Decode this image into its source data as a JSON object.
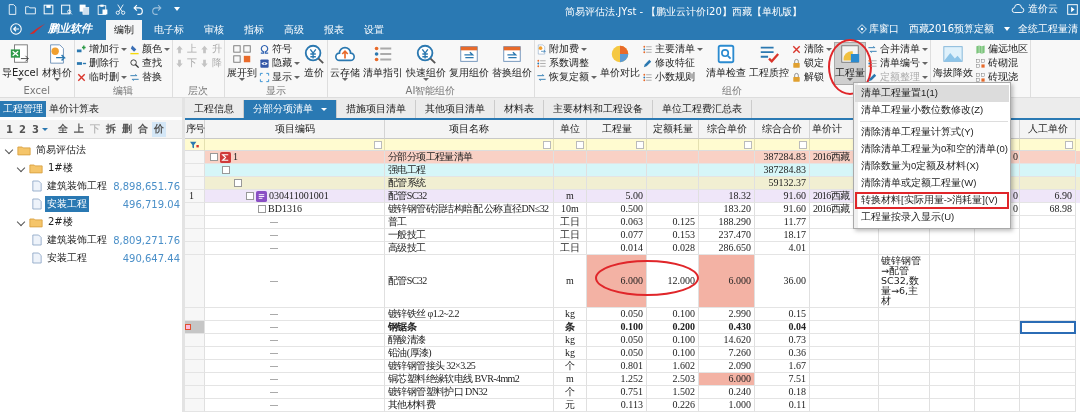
{
  "title_bar": {
    "title": "简易评估法.JYst - 【鹏业云计价i20】西藏【单机版】",
    "cloud_label": "造价云"
  },
  "menu_bar": {
    "brand": "鹏业软件",
    "tabs": [
      {
        "label": "编制",
        "selected": true
      },
      {
        "label": "电子标",
        "selected": false
      },
      {
        "label": "审核",
        "selected": false
      },
      {
        "label": "指标",
        "selected": false
      },
      {
        "label": "高级",
        "selected": false
      },
      {
        "label": "报表",
        "selected": false
      },
      {
        "label": "设置",
        "selected": false
      }
    ],
    "library_window": "库窗口",
    "quota_set": "西藏2016预算定额",
    "bill_set": "全统工程量清"
  },
  "ribbon": {
    "groups": [
      {
        "label": "Excel",
        "columns": [
          [
            {
              "label": "导Excel",
              "dropdown": true,
              "disabled": false,
              "pressed": false,
              "circled": false
            }
          ],
          [
            {
              "label": "材料价",
              "dropdown": true,
              "disabled": false,
              "pressed": false,
              "circled": false
            }
          ]
        ]
      },
      {
        "label": "编辑",
        "columns": [
          [
            {
              "label": "增加行",
              "dropdown": true,
              "disabled": false,
              "pressed": false,
              "circled": false
            },
            {
              "label": "删除行",
              "dropdown": false,
              "disabled": false,
              "pressed": false,
              "circled": false
            },
            {
              "label": "临时删",
              "dropdown": true,
              "disabled": false,
              "pressed": false,
              "circled": false
            }
          ],
          [
            {
              "label": "颜色",
              "dropdown": true,
              "disabled": false,
              "pressed": false,
              "circled": false
            },
            {
              "label": "查找",
              "dropdown": false,
              "disabled": false,
              "pressed": false,
              "circled": false
            },
            {
              "label": "替换",
              "dropdown": false,
              "disabled": false,
              "pressed": false,
              "circled": false
            }
          ]
        ]
      },
      {
        "label": "层次",
        "columns": [
          [
            {
              "label": "上",
              "dropdown": false,
              "disabled": true,
              "pressed": false,
              "circled": false
            },
            {
              "label": "下",
              "dropdown": false,
              "disabled": true,
              "pressed": false,
              "circled": false
            }
          ],
          [
            {
              "label": "升",
              "dropdown": false,
              "disabled": true,
              "pressed": false,
              "circled": false
            },
            {
              "label": "降",
              "dropdown": false,
              "disabled": true,
              "pressed": false,
              "circled": false
            }
          ]
        ]
      },
      {
        "label": "显示",
        "columns": [
          [
            {
              "label": "展开到",
              "dropdown": true,
              "disabled": false,
              "pressed": false,
              "circled": false
            }
          ],
          [
            {
              "label": "符号",
              "dropdown": false,
              "disabled": false,
              "pressed": false,
              "circled": false
            },
            {
              "label": "隐藏",
              "dropdown": true,
              "disabled": false,
              "pressed": false,
              "circled": false
            },
            {
              "label": "显示",
              "dropdown": true,
              "disabled": false,
              "pressed": false,
              "circled": false
            }
          ],
          [
            {
              "label": "造价",
              "dropdown": false,
              "disabled": false,
              "pressed": false,
              "circled": false
            }
          ]
        ]
      },
      {
        "label": "AI智能组价",
        "columns": [
          [
            {
              "label": "云存储",
              "dropdown": true,
              "disabled": false,
              "pressed": false,
              "circled": false
            }
          ],
          [
            {
              "label": "清单指引",
              "dropdown": false,
              "disabled": false,
              "pressed": false,
              "circled": false
            }
          ],
          [
            {
              "label": "快速组价",
              "dropdown": true,
              "disabled": false,
              "pressed": false,
              "circled": false
            }
          ],
          [
            {
              "label": "复用组价",
              "dropdown": false,
              "disabled": false,
              "pressed": false,
              "circled": false
            }
          ],
          [
            {
              "label": "替换组价",
              "dropdown": false,
              "disabled": false,
              "pressed": false,
              "circled": false
            }
          ]
        ]
      },
      {
        "label": "组价",
        "columns": [
          [
            {
              "label": "附加费",
              "dropdown": true,
              "disabled": false,
              "pressed": false,
              "circled": false
            },
            {
              "label": "系数调整",
              "dropdown": false,
              "disabled": false,
              "pressed": false,
              "circled": false
            },
            {
              "label": "恢复定额",
              "dropdown": true,
              "disabled": false,
              "pressed": false,
              "circled": false
            }
          ],
          [
            {
              "label": "单价对比",
              "dropdown": false,
              "disabled": false,
              "pressed": false,
              "circled": false
            }
          ],
          [
            {
              "label": "主要清单",
              "dropdown": true,
              "disabled": false,
              "pressed": false,
              "circled": false
            },
            {
              "label": "修改特征",
              "dropdown": false,
              "disabled": false,
              "pressed": false,
              "circled": false
            },
            {
              "label": "小数规则",
              "dropdown": false,
              "disabled": false,
              "pressed": false,
              "circled": false
            }
          ],
          [
            {
              "label": "清单检查",
              "dropdown": false,
              "disabled": false,
              "pressed": false,
              "circled": false
            }
          ],
          [
            {
              "label": "工程质控",
              "dropdown": false,
              "disabled": false,
              "pressed": false,
              "circled": false
            }
          ],
          [
            {
              "label": "清除",
              "dropdown": true,
              "disabled": false,
              "pressed": false,
              "circled": false
            },
            {
              "label": "锁定",
              "dropdown": false,
              "disabled": false,
              "pressed": false,
              "circled": false
            },
            {
              "label": "解锁",
              "dropdown": false,
              "disabled": false,
              "pressed": false,
              "circled": false
            }
          ],
          [
            {
              "label": "工程量",
              "dropdown": true,
              "disabled": false,
              "pressed": true,
              "circled": true
            }
          ],
          [
            {
              "label": "合并清单",
              "dropdown": true,
              "disabled": false,
              "pressed": false,
              "circled": false
            },
            {
              "label": "清单编号",
              "dropdown": true,
              "disabled": false,
              "pressed": false,
              "circled": false
            },
            {
              "label": "定额整理",
              "dropdown": true,
              "disabled": true,
              "pressed": false,
              "circled": false
            }
          ]
        ]
      },
      {
        "columns": [
          [
            {
              "label": "海拔降效",
              "dropdown": false,
              "disabled": false,
              "pressed": false,
              "circled": false
            }
          ],
          [
            {
              "label": "偏远地区",
              "dropdown": false,
              "disabled": false,
              "pressed": false,
              "circled": false
            },
            {
              "label": "砖砌混",
              "dropdown": false,
              "disabled": false,
              "pressed": false,
              "circled": false
            },
            {
              "label": "砖现浇",
              "dropdown": false,
              "disabled": false,
              "pressed": false,
              "circled": false
            }
          ]
        ]
      }
    ]
  },
  "side_panel": {
    "tabs": [
      {
        "label": "工程管理",
        "selected": true
      },
      {
        "label": "单价计算表",
        "selected": false
      }
    ],
    "toolbar": [
      {
        "label": "1",
        "dropdown": false,
        "disabled": false,
        "selected": false
      },
      {
        "label": "2",
        "dropdown": false,
        "disabled": false,
        "selected": false
      },
      {
        "label": "3",
        "dropdown": true,
        "disabled": false,
        "selected": false
      },
      {
        "label": "全",
        "dropdown": false,
        "disabled": false,
        "selected": false
      },
      {
        "label": "上",
        "dropdown": false,
        "disabled": false,
        "selected": false
      },
      {
        "label": "下",
        "dropdown": false,
        "disabled": true,
        "selected": false
      },
      {
        "label": "拆",
        "dropdown": false,
        "disabled": false,
        "selected": false
      },
      {
        "label": "删",
        "dropdown": false,
        "disabled": false,
        "selected": false
      },
      {
        "label": "合",
        "dropdown": false,
        "disabled": false,
        "selected": false
      },
      {
        "label": "价",
        "dropdown": false,
        "disabled": false,
        "selected": true
      }
    ],
    "tree": [
      {
        "label": "简易评估法",
        "expanded": true,
        "selected": false,
        "children": [
          {
            "label": "1#楼",
            "expanded": true,
            "selected": false,
            "children": [
              {
                "label": "建筑装饰工程",
                "amount": "8,898,651.76",
                "selected": false
              },
              {
                "label": "安装工程",
                "amount": "496,719.04",
                "selected": true
              }
            ]
          },
          {
            "label": "2#楼",
            "expanded": true,
            "selected": false,
            "children": [
              {
                "label": "建筑装饰工程",
                "amount": "8,809,271.76",
                "selected": false
              },
              {
                "label": "安装工程",
                "amount": "490,647.44",
                "selected": false
              }
            ]
          }
        ]
      }
    ]
  },
  "doc_tabs": [
    {
      "label": "工程信息",
      "selected": false,
      "dropdown": false
    },
    {
      "label": "分部分项清单",
      "selected": true,
      "dropdown": true
    },
    {
      "label": "措施项目清单",
      "selected": false,
      "dropdown": false
    },
    {
      "label": "其他项目清单",
      "selected": false,
      "dropdown": false
    },
    {
      "label": "材料表",
      "selected": false,
      "dropdown": false
    },
    {
      "label": "主要材料和工程设备",
      "selected": false,
      "dropdown": false
    },
    {
      "label": "单位工程费汇总表",
      "selected": false,
      "dropdown": false
    }
  ],
  "table": {
    "columns": [
      {
        "label": "序号",
        "filter": false
      },
      {
        "label": "项目编码",
        "filter": true
      },
      {
        "label": "项目名称",
        "filter": true
      },
      {
        "label": "单位",
        "filter": true
      },
      {
        "label": "工程量",
        "filter": true
      },
      {
        "label": "定额耗量",
        "filter": false
      },
      {
        "label": "综合单价",
        "filter": true
      },
      {
        "label": "综合合价",
        "filter": true
      },
      {
        "label": "单价计"
      },
      {},
      {},
      {},
      {
        "label": "人工单价",
        "filter": true
      }
    ],
    "rows": [
      {
        "kind": "section",
        "selected": false,
        "bold": false,
        "circled": false,
        "highlight_qty": false,
        "highlight_unit_price": false,
        "code": "1",
        "name": "分部分项工程量清单",
        "total": "387284.83",
        "pricing": "2016西藏",
        "column_12": "0"
      },
      {
        "kind": "subsection",
        "selected": false,
        "bold": false,
        "circled": false,
        "highlight_qty": false,
        "highlight_unit_price": false,
        "name": "强电工程",
        "total": "387284.83"
      },
      {
        "kind": "system",
        "selected": false,
        "bold": false,
        "circled": false,
        "highlight_qty": false,
        "highlight_unit_price": false,
        "name": "配管系统",
        "total": "59132.37"
      },
      {
        "kind": "item",
        "selected": false,
        "bold": false,
        "circled": false,
        "highlight_qty": false,
        "highlight_unit_price": false,
        "no": "1",
        "code": "030411001001",
        "name": "配管SC32",
        "unit": "m",
        "qty": "5.00",
        "unit_price": "18.32",
        "total": "91.60",
        "pricing": "2016西藏",
        "column_12": "0",
        "labor_price": "6.90"
      },
      {
        "kind": "quota",
        "selected": false,
        "bold": false,
        "circled": false,
        "highlight_qty": false,
        "highlight_unit_price": false,
        "code": "BD1316",
        "name": "镀锌钢管砖混结构暗配 公称直径DN≤32",
        "unit": "10m",
        "qty": "0.500",
        "unit_price": "183.20",
        "total": "91.60",
        "pricing": "2016西藏",
        "column_12": "0",
        "labor_price": "68.98"
      },
      {
        "kind": "resource",
        "selected": false,
        "bold": false,
        "circled": false,
        "highlight_qty": false,
        "highlight_unit_price": false,
        "name": "普工",
        "unit": "工日",
        "qty": "0.063",
        "consumption": "0.125",
        "unit_price": "188.290",
        "total": "11.77"
      },
      {
        "kind": "resource",
        "selected": false,
        "bold": false,
        "circled": false,
        "highlight_qty": false,
        "highlight_unit_price": false,
        "name": "一般技工",
        "unit": "工日",
        "qty": "0.077",
        "consumption": "0.153",
        "unit_price": "237.470",
        "total": "18.17"
      },
      {
        "kind": "resource",
        "selected": false,
        "bold": false,
        "circled": false,
        "highlight_qty": false,
        "highlight_unit_price": false,
        "name": "高级技工",
        "unit": "工日",
        "qty": "0.014",
        "consumption": "0.028",
        "unit_price": "286.650",
        "total": "4.01"
      },
      {
        "kind": "resource",
        "selected": false,
        "bold": false,
        "circled": true,
        "highlight_qty": true,
        "highlight_unit_price": true,
        "name": "配管SC32",
        "unit": "m",
        "qty": "6.000",
        "consumption": "12.000",
        "unit_price": "6.000",
        "total": "36.00",
        "column_10": "镀锌钢管→配管SC32,数量→6,主材"
      },
      {
        "kind": "resource",
        "selected": false,
        "bold": false,
        "circled": false,
        "highlight_qty": false,
        "highlight_unit_price": false,
        "name": "镀锌铁丝 φ1.2~2.2",
        "unit": "kg",
        "qty": "0.050",
        "consumption": "0.100",
        "unit_price": "2.990",
        "total": "0.15"
      },
      {
        "kind": "resource",
        "selected": true,
        "bold": true,
        "circled": false,
        "highlight_qty": false,
        "highlight_unit_price": false,
        "name": "钢锯条",
        "unit": "条",
        "qty": "0.100",
        "consumption": "0.200",
        "unit_price": "0.430",
        "total": "0.04"
      },
      {
        "kind": "resource",
        "selected": false,
        "bold": false,
        "circled": false,
        "highlight_qty": false,
        "highlight_unit_price": false,
        "name": "醇酸清漆",
        "unit": "kg",
        "qty": "0.050",
        "consumption": "0.100",
        "unit_price": "14.620",
        "total": "0.73"
      },
      {
        "kind": "resource",
        "selected": false,
        "bold": false,
        "circled": false,
        "highlight_qty": false,
        "highlight_unit_price": false,
        "name": "铅油(厚漆)",
        "unit": "kg",
        "qty": "0.050",
        "consumption": "0.100",
        "unit_price": "7.260",
        "total": "0.36"
      },
      {
        "kind": "resource",
        "selected": false,
        "bold": false,
        "circled": false,
        "highlight_qty": false,
        "highlight_unit_price": false,
        "name": "镀锌钢管接头 32×3.25",
        "unit": "个",
        "qty": "0.801",
        "consumption": "1.602",
        "unit_price": "2.090",
        "total": "1.67"
      },
      {
        "kind": "resource",
        "selected": false,
        "bold": false,
        "circled": false,
        "highlight_qty": false,
        "highlight_unit_price": true,
        "name": "铜芯塑料绝缘软电线 BVR-4mm2",
        "unit": "m",
        "qty": "1.252",
        "consumption": "2.503",
        "unit_price": "6.000",
        "total": "7.51"
      },
      {
        "kind": "resource",
        "selected": false,
        "bold": false,
        "circled": false,
        "highlight_qty": false,
        "highlight_unit_price": false,
        "name": "镀锌钢管塑料护口 DN32",
        "unit": "个",
        "qty": "0.751",
        "consumption": "1.502",
        "unit_price": "0.240",
        "total": "0.18"
      },
      {
        "kind": "resource",
        "selected": false,
        "bold": false,
        "circled": false,
        "highlight_qty": false,
        "highlight_unit_price": false,
        "name": "其他材料费",
        "unit": "元",
        "qty": "0.113",
        "consumption": "0.226",
        "unit_price": "1.000",
        "total": "0.11"
      }
    ]
  },
  "context_menu": {
    "items": [
      {
        "label": "清单工程量置1(1)",
        "selected": true,
        "boxed": false
      },
      {
        "label": "清单工程量小数位数修改(Z)",
        "selected": false,
        "boxed": false
      },
      {
        "label": "清除清单工程量计算式(Y)",
        "selected": false,
        "boxed": false
      },
      {
        "label": "清除清单工程量为0和空的清单(0)",
        "selected": false,
        "boxed": false
      },
      {
        "label": "清除数量为0定额及材料(X)",
        "selected": false,
        "boxed": false
      },
      {
        "label": "清除清单或定额工程量(W)",
        "selected": false,
        "boxed": false
      },
      {
        "label": "转换材料[实际用量->消耗量](V)",
        "selected": false,
        "boxed": true
      },
      {
        "label": "工程量按录入显示(U)",
        "selected": false,
        "boxed": false
      }
    ]
  }
}
